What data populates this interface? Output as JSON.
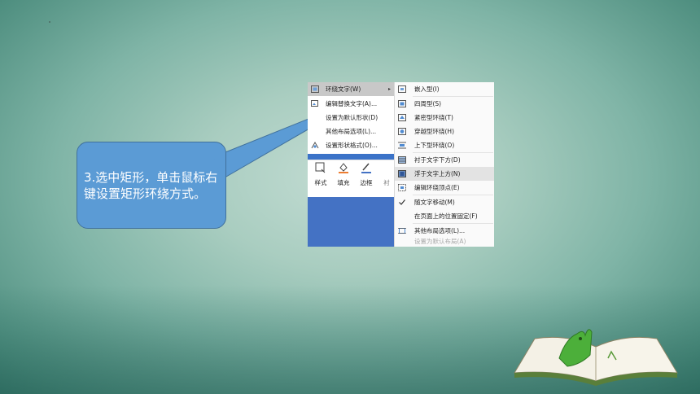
{
  "context_menu": {
    "items": [
      {
        "label": "环绕文字(W)",
        "icon": "wrap-text-icon",
        "has_submenu": true,
        "active": true
      },
      {
        "label": "编辑替换文字(A)...",
        "icon": "alt-text-icon"
      },
      {
        "label": "设置为默认形状(D)",
        "icon": ""
      },
      {
        "label": "其他布局选项(L)...",
        "icon": ""
      },
      {
        "label": "设置形状格式(O)...",
        "icon": "format-shape-icon"
      }
    ],
    "submenu_arrow": "▸"
  },
  "ribbon": {
    "style_label": "样式",
    "fill_label": "填充",
    "outline_label": "边框",
    "cut_label": "衬"
  },
  "submenu": {
    "items": [
      {
        "label": "嵌入型(I)",
        "icon": "inline-wrap-icon"
      },
      {
        "label": "四周型(S)",
        "icon": "square-wrap-icon"
      },
      {
        "label": "紧密型环绕(T)",
        "icon": "tight-wrap-icon"
      },
      {
        "label": "穿越型环绕(H)",
        "icon": "through-wrap-icon"
      },
      {
        "label": "上下型环绕(O)",
        "icon": "top-bottom-wrap-icon"
      },
      {
        "label": "衬于文字下方(D)",
        "icon": "behind-text-icon"
      },
      {
        "label": "浮于文字上方(N)",
        "icon": "in-front-text-icon"
      },
      {
        "label": "编辑环绕顶点(E)",
        "icon": "edit-wrap-points-icon"
      },
      {
        "label": "随文字移动(M)",
        "icon": "check-icon"
      },
      {
        "label": "在页面上的位置固定(F)",
        "icon": ""
      },
      {
        "label": "其他布局选项(L)...",
        "icon": "layout-options-icon"
      },
      {
        "label": "设置为默认布局(A)",
        "icon": "",
        "disabled": true
      }
    ]
  },
  "callout": {
    "text": "3.选中矩形，单击鼠标右键设置矩形环绕方式。"
  },
  "colors": {
    "callout_fill": "#5b9bd5",
    "menu_blue": "#4472c4",
    "fill_orange": "#ed7d31"
  }
}
